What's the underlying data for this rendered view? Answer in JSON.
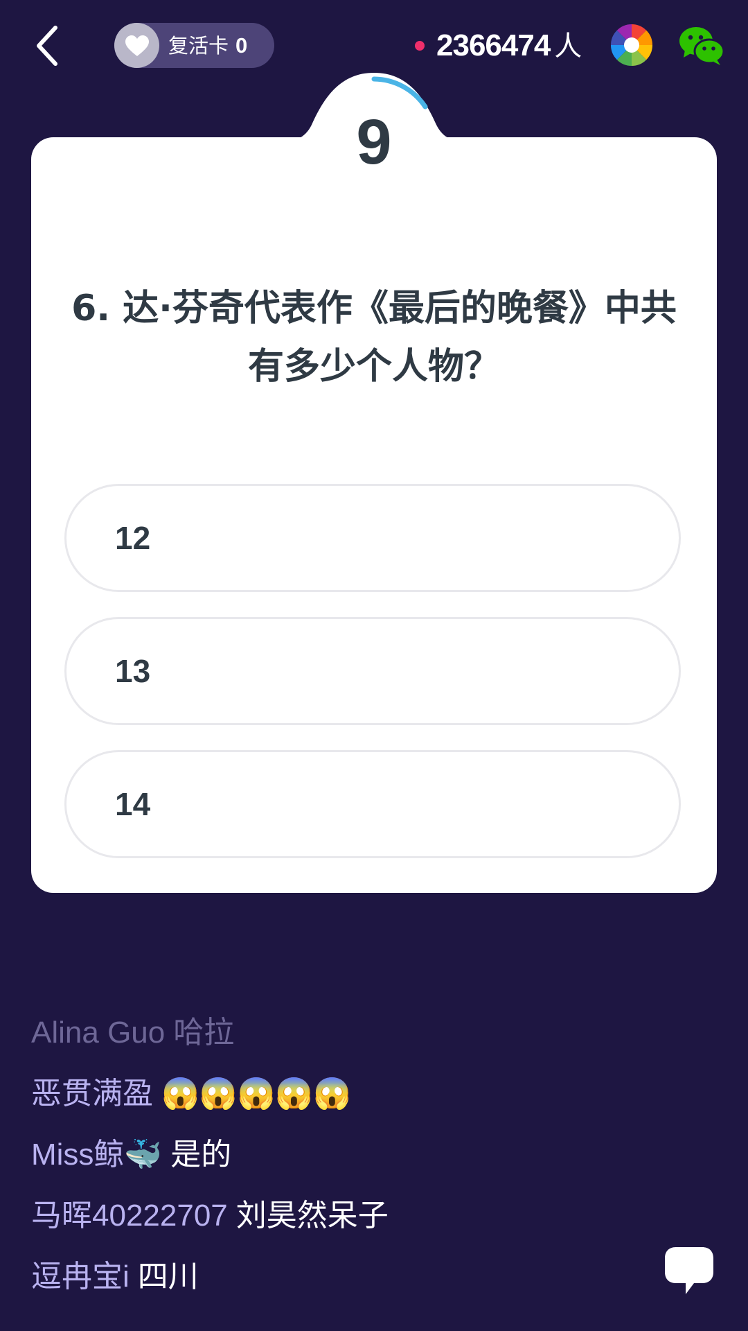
{
  "header": {
    "revive_card": {
      "label": "复活卡",
      "count": "0"
    },
    "viewers": {
      "count": "2366474",
      "unit": "人"
    },
    "icons": [
      "back-icon",
      "heart-icon",
      "moments-icon",
      "wechat-icon"
    ],
    "live_dot_color": "#ef2f6b"
  },
  "quiz": {
    "timer": "9",
    "timer_color": "#4ab4e6",
    "question": "6. 达·芬奇代表作《最后的晚餐》中共有多少个人物？",
    "options": [
      {
        "label": "12"
      },
      {
        "label": "13"
      },
      {
        "label": "14"
      }
    ]
  },
  "chat": {
    "messages": [
      {
        "user": "Alina Guo",
        "text": "哈拉"
      },
      {
        "user": "恶贯满盈",
        "text": "😱😱😱😱😱"
      },
      {
        "user": "Miss鲸🐳",
        "text": "是的"
      },
      {
        "user": "马晖40222707",
        "text": "刘昊然呆子"
      },
      {
        "user": "逗冉宝i",
        "text": "四川"
      }
    ],
    "icon": "chat-bubble-icon"
  },
  "colors": {
    "background": "#1e1642",
    "card": "#ffffff",
    "text_dark": "#2f3a44",
    "username": "#b9b2f0"
  }
}
